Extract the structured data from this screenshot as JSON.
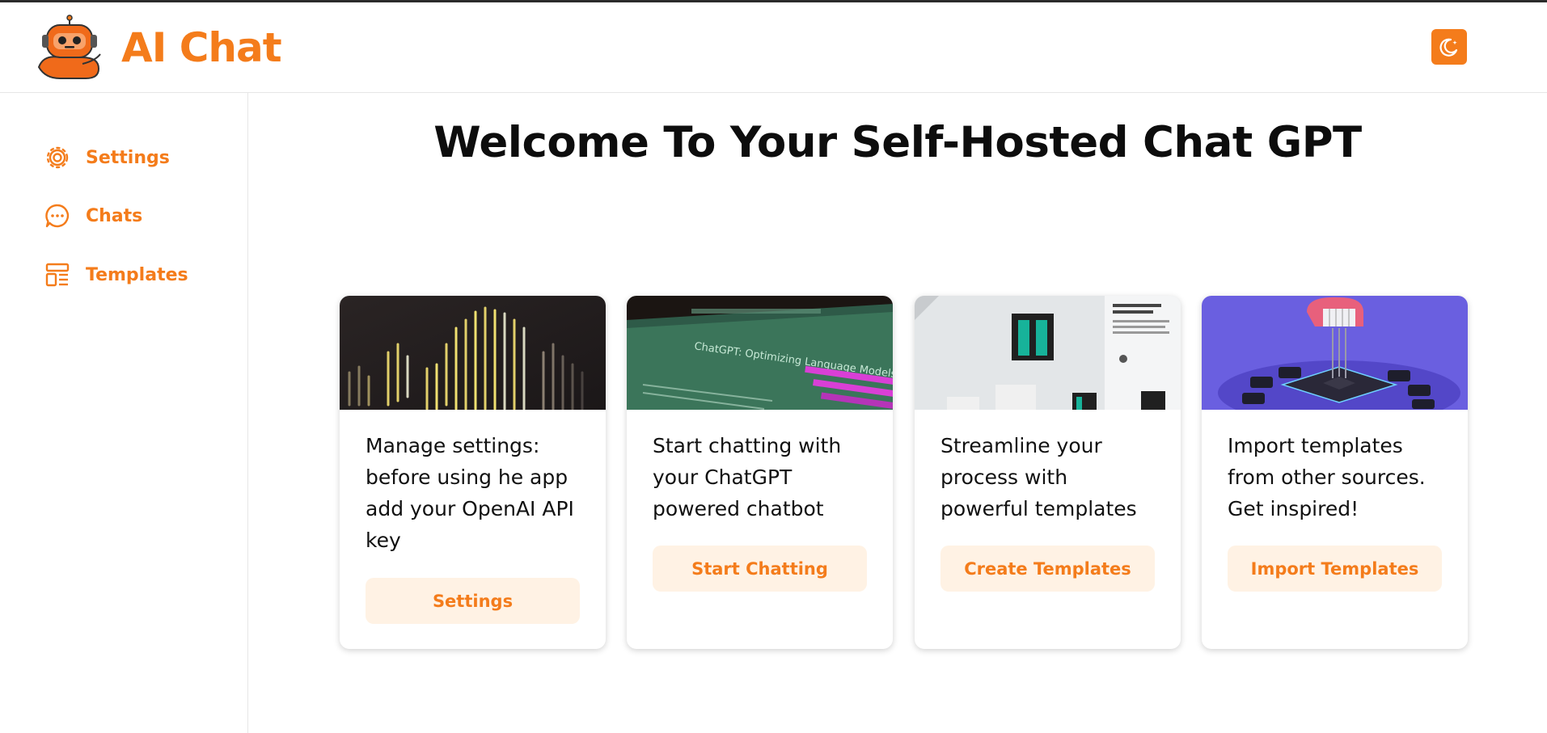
{
  "app": {
    "title": "AI Chat",
    "brand_color": "#f47c1b",
    "theme_toggle_icon": "moon-icon"
  },
  "sidebar": {
    "items": [
      {
        "label": "Settings",
        "icon": "gear-icon"
      },
      {
        "label": "Chats",
        "icon": "chat-bubble-icon"
      },
      {
        "label": "Templates",
        "icon": "template-layout-icon"
      }
    ]
  },
  "main": {
    "title": "Welcome To Your Self-Hosted Chat GPT",
    "cards": [
      {
        "text": "Manage settings: before using he app add your OpenAI API key",
        "button": "Settings",
        "image": "code-terminal-image"
      },
      {
        "text": "Start chatting with your ChatGPT powered chatbot",
        "button": "Start Chatting",
        "image": "chatgpt-screen-image",
        "image_text": "ChatGPT: Optimizing Language Models for Dialogue"
      },
      {
        "text": "Streamline your process with powerful templates",
        "button": "Create Templates",
        "image": "templates-ui-image"
      },
      {
        "text": "Import templates from other sources. Get inspired!",
        "button": "Import Templates",
        "image": "import-chip-image"
      }
    ]
  }
}
